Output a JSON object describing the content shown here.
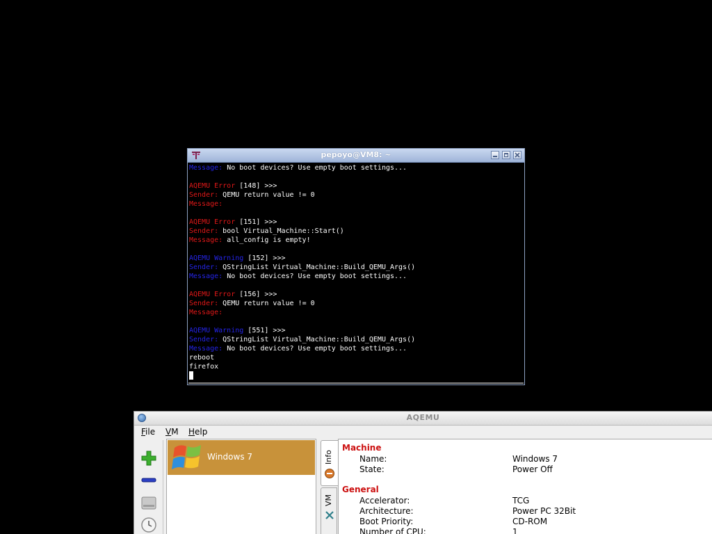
{
  "terminal": {
    "title": "pepoyo@VM8: ~",
    "lines": [
      [
        {
          "t": "Message:",
          "c": "warn"
        },
        {
          "t": " No boot devices? Use empty boot settings...",
          "c": ""
        }
      ],
      [],
      [
        {
          "t": "AQEMU Error",
          "c": "err"
        },
        {
          "t": " [148] >>>",
          "c": ""
        }
      ],
      [
        {
          "t": "Sender:",
          "c": "err"
        },
        {
          "t": " QEMU return value != 0",
          "c": ""
        }
      ],
      [
        {
          "t": "Message:",
          "c": "err"
        }
      ],
      [],
      [
        {
          "t": "AQEMU Error",
          "c": "err"
        },
        {
          "t": " [151] >>>",
          "c": ""
        }
      ],
      [
        {
          "t": "Sender:",
          "c": "err"
        },
        {
          "t": " bool Virtual_Machine::Start()",
          "c": ""
        }
      ],
      [
        {
          "t": "Message:",
          "c": "err"
        },
        {
          "t": " all_config is empty!",
          "c": ""
        }
      ],
      [],
      [
        {
          "t": "AQEMU Warning",
          "c": "warn"
        },
        {
          "t": " [152] >>>",
          "c": ""
        }
      ],
      [
        {
          "t": "Sender:",
          "c": "warn"
        },
        {
          "t": " QStringList Virtual_Machine::Build_QEMU_Args()",
          "c": ""
        }
      ],
      [
        {
          "t": "Message:",
          "c": "warn"
        },
        {
          "t": " No boot devices? Use empty boot settings...",
          "c": ""
        }
      ],
      [],
      [
        {
          "t": "AQEMU Error",
          "c": "err"
        },
        {
          "t": " [156] >>>",
          "c": ""
        }
      ],
      [
        {
          "t": "Sender:",
          "c": "err"
        },
        {
          "t": " QEMU return value != 0",
          "c": ""
        }
      ],
      [
        {
          "t": "Message:",
          "c": "err"
        }
      ],
      [],
      [
        {
          "t": "AQEMU Warning",
          "c": "warn"
        },
        {
          "t": " [551] >>>",
          "c": ""
        }
      ],
      [
        {
          "t": "Sender:",
          "c": "warn"
        },
        {
          "t": " QStringList Virtual_Machine::Build_QEMU_Args()",
          "c": ""
        }
      ],
      [
        {
          "t": "Message:",
          "c": "warn"
        },
        {
          "t": " No boot devices? Use empty boot settings...",
          "c": ""
        }
      ],
      [
        {
          "t": "reboot",
          "c": ""
        }
      ],
      [
        {
          "t": "firefox",
          "c": ""
        }
      ]
    ],
    "colors": {
      "err": "#e01818",
      "warn": "#2424e6",
      "text": "#ffffff",
      "bg": "#000000"
    }
  },
  "aqemu": {
    "title": "AQEMU",
    "menu": {
      "file": {
        "accel": "F",
        "rest": "ile"
      },
      "vm": {
        "accel": "V",
        "rest": "M"
      },
      "help": {
        "accel": "H",
        "rest": "elp"
      }
    },
    "toolbar_icons": [
      "add-vm-icon",
      "remove-vm-icon",
      "hard-disk-icon",
      "clock-icon"
    ],
    "vm_list": [
      {
        "name": "Windows 7",
        "icon": "windows-logo-icon",
        "selected": true
      }
    ],
    "tabs": [
      {
        "label": "Info",
        "icon": "info-tab-icon",
        "active": true
      },
      {
        "label": "VM",
        "icon": "tools-icon",
        "active": false
      }
    ],
    "info": {
      "machine": {
        "heading": "Machine",
        "rows": [
          {
            "label": "Name:",
            "value": "Windows 7"
          },
          {
            "label": "State:",
            "value": "Power Off"
          }
        ]
      },
      "general": {
        "heading": "General",
        "rows": [
          {
            "label": "Accelerator:",
            "value": "TCG"
          },
          {
            "label": "Architecture:",
            "value": "Power PC 32Bit"
          },
          {
            "label": "Boot Priority:",
            "value": "CD-ROM"
          },
          {
            "label": "Number of CPU:",
            "value": "1"
          }
        ]
      }
    },
    "colors": {
      "selected_row": "#c8923a",
      "section_heading": "#cc1111"
    }
  }
}
